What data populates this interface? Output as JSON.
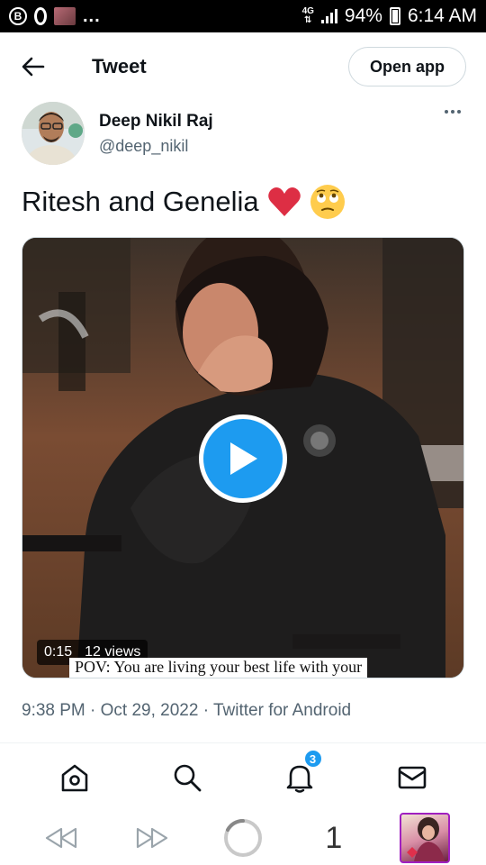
{
  "status_bar": {
    "icons": [
      "b-circle-icon",
      "o-icon",
      "photo-thumb-icon"
    ],
    "b_letter": "B",
    "more": "...",
    "network": "4G",
    "signal": "signal-icon",
    "battery_percent": "94%",
    "battery_icon": "battery-charging-icon",
    "time": "6:14 AM"
  },
  "header": {
    "back_icon": "arrow-left-icon",
    "title": "Tweet",
    "open_app_label": "Open app"
  },
  "tweet": {
    "author_name": "Deep Nikil Raj",
    "author_handle": "@deep_nikil",
    "more_icon": "more-horizontal-icon",
    "text": "Ritesh and Genelia",
    "emojis": [
      "red-heart-emoji",
      "face-rolling-eyes-emoji"
    ],
    "video": {
      "duration": "0:15",
      "views": "12 views",
      "caption": "POV: You are living your best life with your",
      "play_icon": "play-icon"
    },
    "timestamp": "9:38 PM · Oct 29, 2022 · Twitter for Android"
  },
  "bottom_nav": {
    "items": [
      {
        "icon": "home-icon"
      },
      {
        "icon": "search-icon"
      },
      {
        "icon": "bell-icon",
        "badge": "3"
      },
      {
        "icon": "mail-icon"
      }
    ]
  },
  "browser_bar": {
    "back_icon": "rewind-icon",
    "forward_icon": "fast-forward-icon",
    "loading_icon": "loading-spinner-icon",
    "tab_count": "1",
    "tab_thumb_icon": "tab-preview-icon"
  },
  "colors": {
    "accent": "#1d9bf0",
    "text_primary": "#0f1419",
    "text_secondary": "#536471",
    "border": "#cfd9de",
    "status_bar_bg": "#000000"
  }
}
